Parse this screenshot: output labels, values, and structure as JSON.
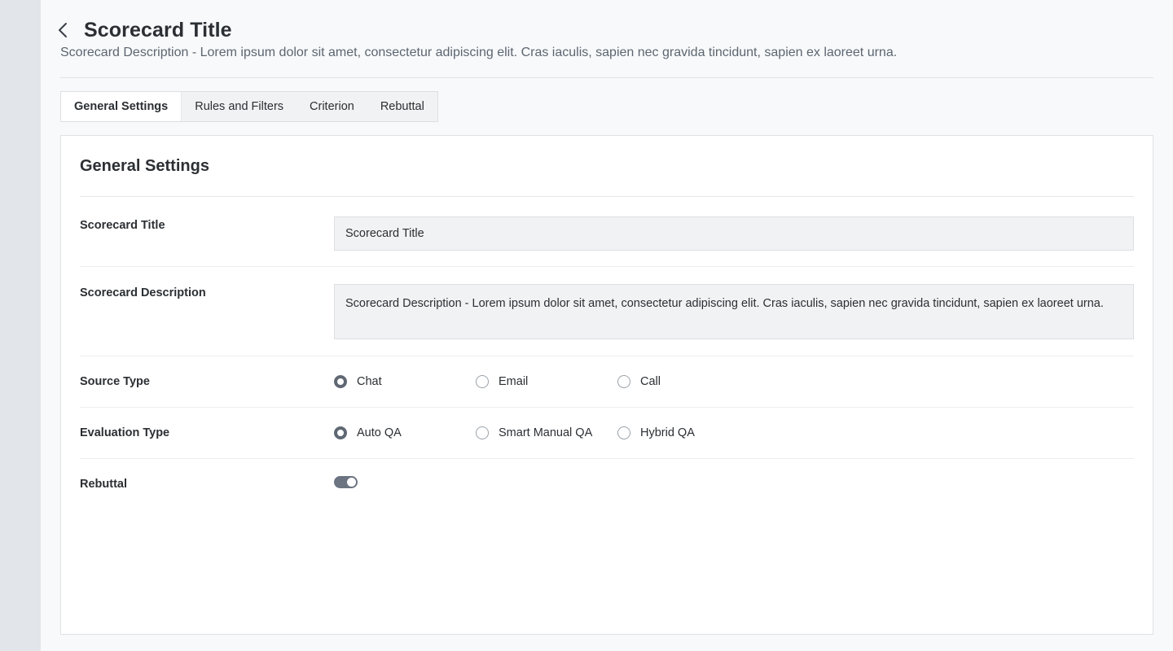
{
  "header": {
    "title": "Scorecard Title",
    "description": "Scorecard Description - Lorem ipsum dolor sit amet, consectetur adipiscing elit. Cras iaculis, sapien nec gravida tincidunt, sapien ex laoreet urna."
  },
  "tabs": [
    {
      "label": "General Settings",
      "active": true
    },
    {
      "label": "Rules and Filters",
      "active": false
    },
    {
      "label": "Criterion",
      "active": false
    },
    {
      "label": "Rebuttal",
      "active": false
    }
  ],
  "card": {
    "title": "General Settings",
    "fields": {
      "scorecard_title": {
        "label": "Scorecard Title",
        "value": "Scorecard Title"
      },
      "scorecard_description": {
        "label": "Scorecard Description",
        "value": "Scorecard Description - Lorem ipsum dolor sit amet, consectetur adipiscing elit. Cras iaculis, sapien nec gravida tincidunt, sapien ex laoreet urna."
      },
      "source_type": {
        "label": "Source Type",
        "options": [
          "Chat",
          "Email",
          "Call"
        ],
        "selected": "Chat"
      },
      "evaluation_type": {
        "label": "Evaluation Type",
        "options": [
          "Auto QA",
          "Smart Manual QA",
          "Hybrid QA"
        ],
        "selected": "Auto QA"
      },
      "rebuttal": {
        "label": "Rebuttal",
        "enabled": true
      }
    }
  },
  "icons": {
    "back": "chevron-left-icon"
  },
  "colors": {
    "accent": "#5f6873",
    "background": "#f8f9fb",
    "rail": "#e2e5ea"
  }
}
